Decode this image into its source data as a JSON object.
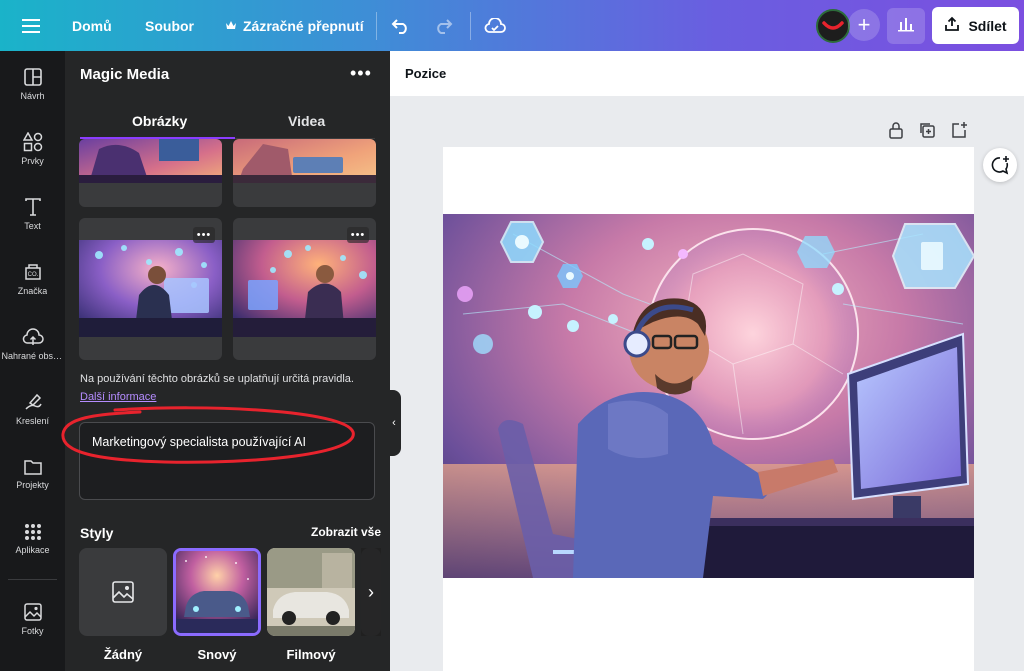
{
  "topbar": {
    "menu_icon": "hamburger-icon",
    "home": "Domů",
    "file": "Soubor",
    "magic_switch": "Zázračné přepnutí",
    "magic_icon": "crown-icon",
    "undo_icon": "undo-icon",
    "redo_icon": "redo-icon",
    "cloud_icon": "cloud-check-icon",
    "add_icon": "plus-icon",
    "stats_icon": "bar-chart-icon",
    "share": "Sdílet",
    "share_icon": "upload-icon"
  },
  "rail": {
    "items": [
      {
        "label": "Návrh",
        "icon": "layout-icon"
      },
      {
        "label": "Prvky",
        "icon": "shapes-icon"
      },
      {
        "label": "Text",
        "icon": "text-icon"
      },
      {
        "label": "Značka",
        "icon": "brand-icon"
      },
      {
        "label": "Nahrané obsahy",
        "icon": "cloud-upload-icon"
      },
      {
        "label": "Kreslení",
        "icon": "draw-icon"
      },
      {
        "label": "Projekty",
        "icon": "folder-icon"
      },
      {
        "label": "Aplikace",
        "icon": "apps-grid-icon"
      },
      {
        "label": "Fotky",
        "icon": "photo-icon"
      }
    ]
  },
  "panel": {
    "title": "Magic Media",
    "tabs": [
      {
        "label": "Obrázky",
        "active": true
      },
      {
        "label": "Videa",
        "active": false
      }
    ],
    "notice": "Na používání těchto obrázků se uplatňují určitá pravidla.",
    "notice_link": "Další informace",
    "prompt": "Marketingový specialista používající AI",
    "styles_heading": "Styly",
    "styles_all": "Zobrazit vše",
    "styles": [
      {
        "label": "Žádný",
        "selected": false
      },
      {
        "label": "Snový",
        "selected": true
      },
      {
        "label": "Filmový",
        "selected": false
      }
    ]
  },
  "workspace": {
    "position_label": "Pozice"
  },
  "colors": {
    "accent": "#8b3dff",
    "annotation": "#e8232d"
  }
}
